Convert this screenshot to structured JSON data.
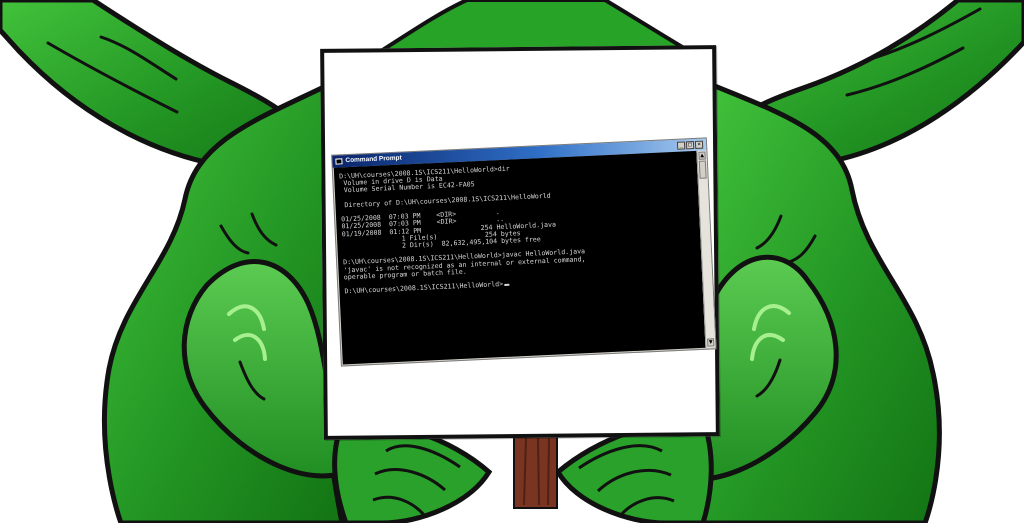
{
  "window": {
    "title": "Command Prompt",
    "buttons": {
      "minimize": "_",
      "maximize": "□",
      "close": "×"
    }
  },
  "console": {
    "lines": [
      "D:\\UH\\courses\\2008.1S\\ICS211\\HelloWorld>dir",
      " Volume in drive D is Data",
      " Volume Serial Number is EC42-FA05",
      "",
      " Directory of D:\\UH\\courses\\2008.1S\\ICS211\\HelloWorld",
      "",
      "01/25/2008  07:03 PM    <DIR>          .",
      "01/25/2008  07:03 PM    <DIR>          ..",
      "01/19/2008  01:12 PM               254 HelloWorld.java",
      "               1 File(s)            254 bytes",
      "               2 Dir(s)  82,632,495,104 bytes free",
      "",
      "D:\\UH\\courses\\2008.1S\\ICS211\\HelloWorld>javac HelloWorld.java",
      "'javac' is not recognized as an internal or external command,",
      "operable program or batch file.",
      "",
      "D:\\UH\\courses\\2008.1S\\ICS211\\HelloWorld>"
    ]
  },
  "colors": {
    "troll_green": "#2fa52f",
    "troll_dark_green": "#1d7a1d",
    "title_bar": "#0a246a",
    "console_bg": "#000000",
    "console_text": "#d8d8d8",
    "sign_post": "#7a3522"
  },
  "icons": {
    "title": "command-prompt-icon",
    "scroll_up": "scroll-up-arrow-icon",
    "scroll_down": "scroll-down-arrow-icon"
  }
}
